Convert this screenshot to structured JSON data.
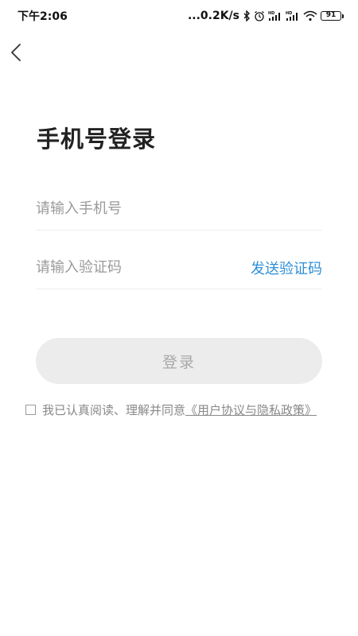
{
  "status_bar": {
    "time": "下午2:06",
    "network_speed": "...0.2K/s",
    "battery": "91"
  },
  "icons": {
    "back": "chevron-left-icon",
    "bluetooth": "bluetooth-icon",
    "alarm": "alarm-clock-icon",
    "signal_1": "hd-signal-icon",
    "signal_2": "hd-signal-icon",
    "wifi": "wifi-icon",
    "battery": "battery-icon"
  },
  "page": {
    "title": "手机号登录"
  },
  "form": {
    "phone_placeholder": "请输入手机号",
    "phone_value": "",
    "code_placeholder": "请输入验证码",
    "code_value": "",
    "send_code_label": "发送验证码",
    "login_label": "登录"
  },
  "agreement": {
    "checked": false,
    "text": "我已认真阅读、理解并同意",
    "link_text": "《用户协议与隐私政策》"
  },
  "colors": {
    "accent": "#2f8fd6",
    "button_bg": "#ececec",
    "button_text": "#a8a8a8",
    "placeholder": "#9a9a9a"
  }
}
